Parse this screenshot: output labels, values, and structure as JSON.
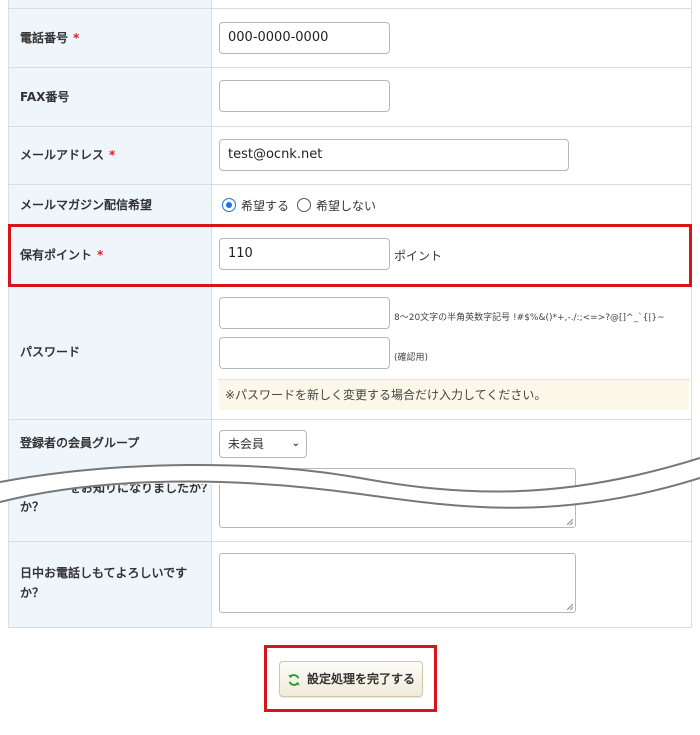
{
  "form": {
    "rows": {
      "phone": {
        "label": "電話番号",
        "required_mark": "*",
        "value": "000-0000-0000"
      },
      "fax": {
        "label": "FAX番号",
        "value": ""
      },
      "email": {
        "label": "メールアドレス",
        "required_mark": "*",
        "value": "test@ocnk.net"
      },
      "newsletter": {
        "label": "メールマガジン配信希望",
        "option_yes": "希望する",
        "option_no": "希望しない",
        "selected": "希望する"
      },
      "points": {
        "label": "保有ポイント",
        "required_mark": "*",
        "value": "110",
        "unit": "ポイント"
      },
      "password": {
        "label": "パスワード",
        "hint": "8～20文字の半角英数字記号 !#$%&()*+,-./:;<=>?@[]^_`{|}~",
        "confirm_note": "(確認用)",
        "notice": "※パスワードを新しく変更する場合だけ入力してください。"
      },
      "member_group": {
        "label": "登録者の会員グループ",
        "selected": "未会員"
      },
      "referral": {
        "label_partial": "か？",
        "label_cut": "をお知りになりましたか？"
      },
      "daytime_call": {
        "label_line1": "日中お電話しもてよろしいです",
        "label_line2": "か？"
      }
    }
  },
  "submit": {
    "label": "設定処理を完了する",
    "icon": "refresh-icon"
  },
  "colors": {
    "highlight": "#d7141a",
    "label_bg": "#eef5fb",
    "radio_accent": "#1a73e8",
    "required": "#e02020",
    "notice_bg": "#fbf8e9"
  }
}
